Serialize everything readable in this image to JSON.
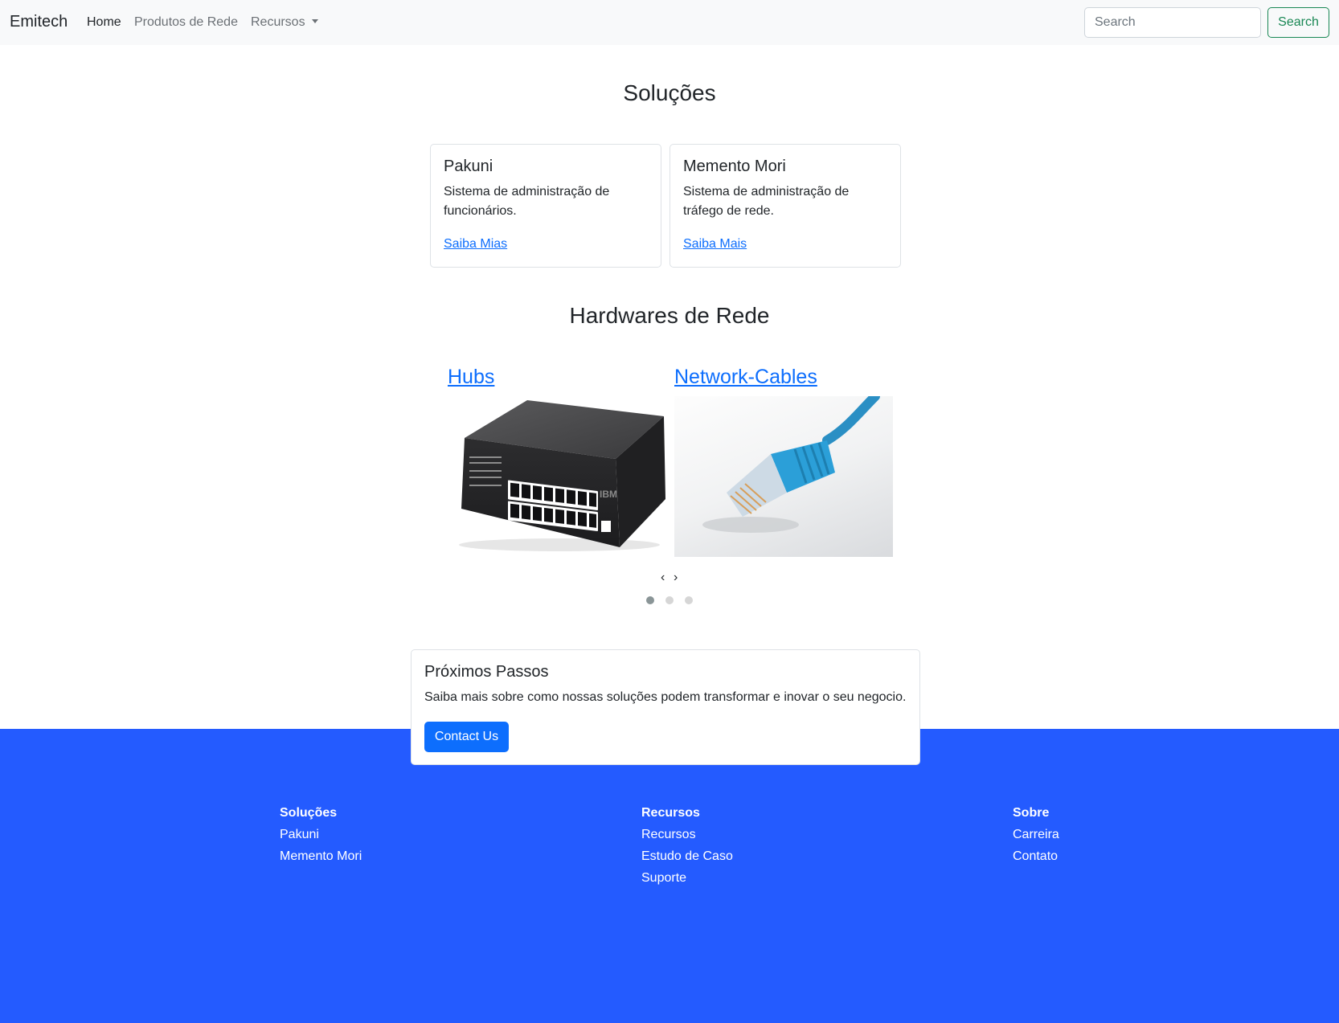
{
  "navbar": {
    "brand": "Emitech",
    "links": [
      {
        "label": "Home"
      },
      {
        "label": "Produtos de Rede"
      },
      {
        "label": "Recursos"
      }
    ],
    "search": {
      "placeholder": "Search",
      "button_label": "Search"
    }
  },
  "solutions": {
    "title": "Soluções",
    "cards": [
      {
        "title": "Pakuni",
        "text": "Sistema de administração de funcionários.",
        "link": "Saiba Mias"
      },
      {
        "title": "Memento Mori",
        "text": "Sistema de administração de tráfego de rede.",
        "link": "Saiba Mais"
      }
    ]
  },
  "hardware": {
    "title": "Hardwares de Rede",
    "items": [
      {
        "label": "Hubs",
        "image": "network-hub-image"
      },
      {
        "label": "Network-Cables",
        "image": "ethernet-cable-image"
      }
    ],
    "prev": "‹",
    "next": "›",
    "active_slide": 1,
    "slide_count": 3
  },
  "next_steps": {
    "title": "Próximos Passos",
    "text": "Saiba mais sobre como nossas soluções podem transformar e inovar o seu negocio.",
    "button": "Contact Us"
  },
  "footer": {
    "columns": [
      {
        "heading": "Soluções",
        "items": [
          "Pakuni",
          "Memento Mori"
        ]
      },
      {
        "heading": "Recursos",
        "items": [
          "Recursos",
          "Estudo de Caso",
          "Suporte"
        ]
      },
      {
        "heading": "Sobre",
        "items": [
          "Carreira",
          "Contato"
        ]
      }
    ]
  },
  "colors": {
    "navbar_bg": "#f8f9fa",
    "link": "#0d6efd",
    "search_button": "#198754",
    "footer_bg": "#245bff"
  }
}
